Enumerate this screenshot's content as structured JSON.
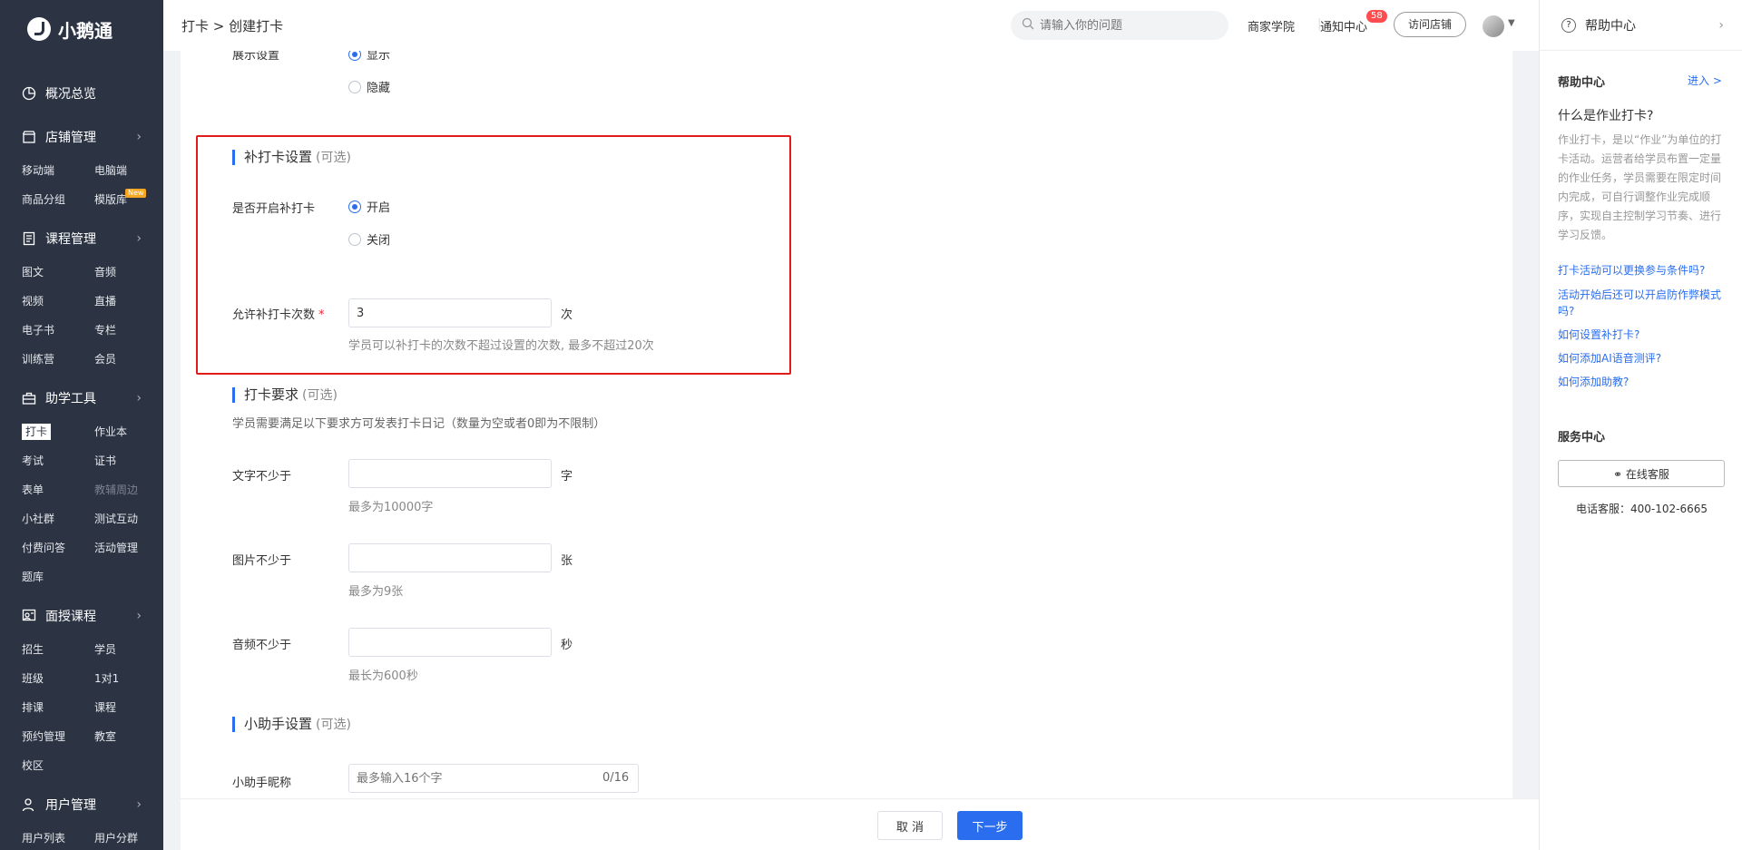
{
  "app": {
    "name": "小鹅通"
  },
  "sidebar": {
    "sections": [
      {
        "label": "概况总览",
        "items": []
      },
      {
        "label": "店铺管理",
        "items": [
          "移动端",
          "电脑端",
          "商品分组",
          "模版库"
        ],
        "tag": "New"
      },
      {
        "label": "课程管理",
        "items": [
          "图文",
          "音频",
          "视频",
          "直播",
          "电子书",
          "专栏",
          "训练营",
          "会员"
        ]
      },
      {
        "label": "助学工具",
        "items": [
          "打卡",
          "作业本",
          "考试",
          "证书",
          "表单",
          "教辅周边",
          "小社群",
          "测试互动",
          "付费问答",
          "活动管理",
          "题库"
        ]
      },
      {
        "label": "面授课程",
        "items": [
          "招生",
          "学员",
          "班级",
          "1对1",
          "排课",
          "课程",
          "预约管理",
          "教室",
          "校区"
        ]
      },
      {
        "label": "用户管理",
        "items": [
          "用户列表",
          "用户分群"
        ]
      }
    ],
    "active_item": "打卡"
  },
  "header": {
    "breadcrumb": "打卡 > 创建打卡",
    "search_placeholder": "请输入你的问题",
    "merchant_academy": "商家学院",
    "notification": "通知中心",
    "notification_count": "58",
    "visit_store": "访问店铺"
  },
  "form": {
    "display_setting": {
      "label": "展示设置",
      "options": [
        "显示",
        "隐藏"
      ],
      "selected": "显示"
    },
    "makeup": {
      "title": "补打卡设置",
      "optional": "(可选)",
      "enable_label": "是否开启补打卡",
      "options": [
        "开启",
        "关闭"
      ],
      "selected": "开启",
      "count_label": "允许补打卡次数",
      "required_mark": "*",
      "count_value": "3",
      "count_unit": "次",
      "count_hint": "学员可以补打卡的次数不超过设置的次数, 最多不超过20次"
    },
    "requirement": {
      "title": "打卡要求",
      "optional": "(可选)",
      "desc": "学员需要满足以下要求方可发表打卡日记（数量为空或者0即为不限制）",
      "text_label": "文字不少于",
      "text_value": "",
      "text_unit": "字",
      "text_hint": "最多为10000字",
      "image_label": "图片不少于",
      "image_value": "",
      "image_unit": "张",
      "image_hint": "最多为9张",
      "audio_label": "音频不少于",
      "audio_value": "",
      "audio_unit": "秒",
      "audio_hint": "最长为600秒"
    },
    "assistant": {
      "title": "小助手设置",
      "optional": "(可选)",
      "nickname_label": "小助手昵称",
      "nickname_placeholder": "最多输入16个字",
      "nickname_counter": "0/16"
    }
  },
  "footer": {
    "cancel": "取 消",
    "next": "下一步"
  },
  "help": {
    "header": "帮助中心",
    "section_title": "帮助中心",
    "enter": "进入 >",
    "question": "什么是作业打卡?",
    "description": "作业打卡，是以“作业”为单位的打卡活动。运营者给学员布置一定量的作业任务，学员需要在限定时间内完成，可自行调整作业完成顺序，实现自主控制学习节奏、进行学习反馈。",
    "links": [
      "打卡活动可以更换参与条件吗?",
      "活动开始后还可以开启防作弊模式吗?",
      "如何设置补打卡?",
      "如何添加AI语音测评?",
      "如何添加助教?"
    ],
    "service_title": "服务中心",
    "online_service": "在线客服",
    "phone": "电话客服：400-102-6665"
  },
  "colors": {
    "primary": "#2a6eef",
    "sidebar_bg": "#2c3444",
    "highlight_border": "#e21c1c"
  }
}
